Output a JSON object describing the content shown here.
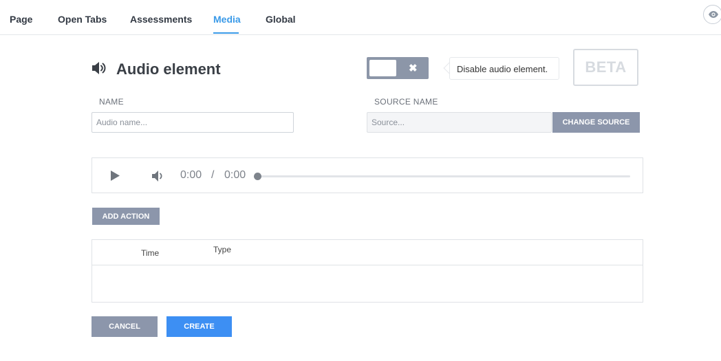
{
  "nav": {
    "tabs": [
      {
        "label": "Page"
      },
      {
        "label": "Open Tabs"
      },
      {
        "label": "Assessments"
      },
      {
        "label": "Media"
      },
      {
        "label": "Global"
      }
    ],
    "active_tab": "Media",
    "preview_icon": "eye-icon"
  },
  "header": {
    "icon": "speaker-icon",
    "title": "Audio element",
    "toggle_icon": "close-icon",
    "tooltip": "Disable audio element.",
    "badge": "BETA"
  },
  "form": {
    "name_label": "NAME",
    "name_placeholder": "Audio name...",
    "source_label": "SOURCE NAME",
    "source_placeholder": "Source...",
    "change_source_label": "CHANGE SOURCE"
  },
  "player": {
    "current_time": "0:00",
    "separator": "/",
    "duration": "0:00",
    "play_icon": "play-icon",
    "volume_icon": "volume-icon",
    "progress": 0
  },
  "actions": {
    "add_action_label": "ADD ACTION",
    "table_headers": [
      "Time",
      "Type"
    ],
    "rows": []
  },
  "footer": {
    "cancel_label": "CANCEL",
    "create_label": "CREATE"
  },
  "colors": {
    "accent": "#3a9ae8",
    "primary_button": "#3d8ff3",
    "secondary_button": "#8c96ab"
  }
}
